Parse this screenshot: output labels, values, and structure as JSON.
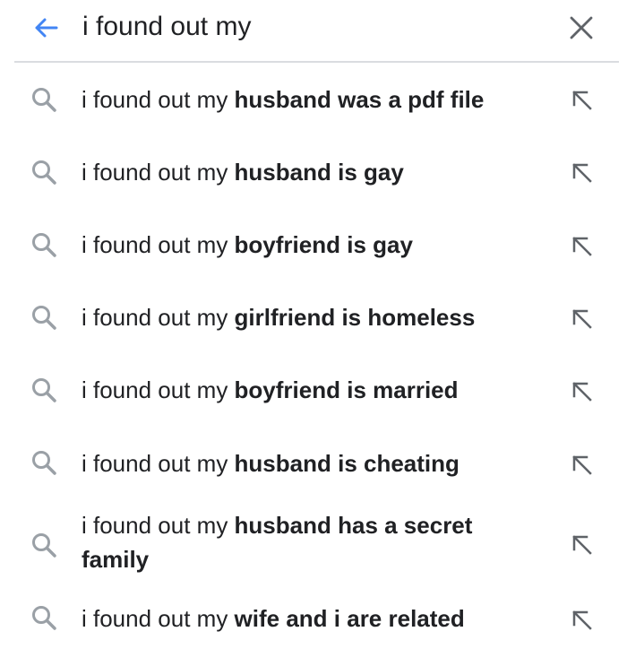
{
  "search": {
    "query": "i found out my"
  },
  "icons": {
    "back": "arrow-back-icon",
    "clear": "close-icon",
    "suggestion": "search-icon",
    "fill": "arrow-up-left-icon",
    "accent_color": "#4285f4",
    "icon_color": "#5f6368"
  },
  "suggestions": [
    {
      "prefix": "i found out my ",
      "completion": "husband was a pdf file"
    },
    {
      "prefix": "i found out my ",
      "completion": "husband is gay"
    },
    {
      "prefix": "i found out my ",
      "completion": "boyfriend is gay"
    },
    {
      "prefix": "i found out my ",
      "completion": "girlfriend is homeless"
    },
    {
      "prefix": "i found out my ",
      "completion": "boyfriend is married"
    },
    {
      "prefix": "i found out my ",
      "completion": "husband is cheating"
    },
    {
      "prefix": "i found out my ",
      "completion": "husband has a secret family"
    },
    {
      "prefix": "i found out my ",
      "completion": "wife and i are related"
    }
  ]
}
